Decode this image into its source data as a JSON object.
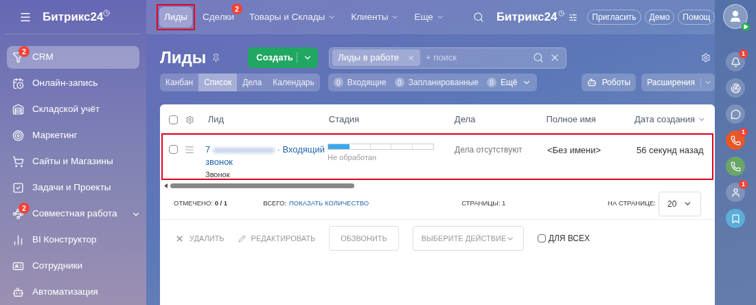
{
  "sidebar": {
    "logo": "Битрикс24",
    "items": [
      {
        "label": "CRM",
        "badge": "2",
        "selected": true
      },
      {
        "label": "Онлайн-запись",
        "selected": false
      },
      {
        "label": "Складской учёт",
        "selected": false
      },
      {
        "label": "Маркетинг",
        "selected": false
      },
      {
        "label": "Сайты и Магазины",
        "selected": false
      },
      {
        "label": "Задачи и Проекты",
        "selected": false
      },
      {
        "label": "Совместная работа",
        "badge": "2",
        "expandable": true,
        "selected": false
      },
      {
        "label": "BI Конструктор",
        "selected": false
      },
      {
        "label": "Сотрудники",
        "selected": false
      },
      {
        "label": "Автоматизация",
        "selected": false
      }
    ]
  },
  "topnav": {
    "tabs": [
      {
        "label": "Лиды",
        "selected": true,
        "highlighted": true
      },
      {
        "label": "Сделки",
        "badge": "2",
        "selected": false
      },
      {
        "label": "Товары и Склады",
        "dropdown": true,
        "selected": false
      },
      {
        "label": "Клиенты",
        "dropdown": true,
        "selected": false
      },
      {
        "label": "Еще",
        "dropdown": true,
        "selected": false
      }
    ],
    "logo": "Битрикс24",
    "buttons": [
      "Пригласить",
      "Демо",
      "Помощ"
    ]
  },
  "header": {
    "title": "Лиды",
    "create": "Создать",
    "filter_chip": "Лиды в работе",
    "search_placeholder": "+ поиск"
  },
  "views": [
    {
      "label": "Канбан",
      "selected": false
    },
    {
      "label": "Список",
      "selected": true
    },
    {
      "label": "Дела",
      "selected": false
    },
    {
      "label": "Календарь",
      "selected": false
    }
  ],
  "counters": [
    {
      "count": "0",
      "label": "Входящие"
    },
    {
      "count": "0",
      "label": "Запланированные"
    },
    {
      "count": "0",
      "label": "Ещё",
      "dropdown": true
    }
  ],
  "toolbar": {
    "robots": "Роботы",
    "extensions": "Расширения"
  },
  "table": {
    "all_checked": false,
    "columns": [
      "Лид",
      "Стадия",
      "Дела",
      "Полное имя",
      "Дата создания"
    ],
    "rows": [
      {
        "highlighted": true,
        "checked": false,
        "lead_prefix": "7",
        "lead_suffix": "· Входящий звонок",
        "source": "Звонок",
        "stage": {
          "label": "Не обработан",
          "level": 0.2
        },
        "activities": "Дела отсутствуют",
        "name": "<Без имени>",
        "created": "56 секунд назад"
      }
    ]
  },
  "footer": {
    "checked_label": "ОТМЕЧЕНО:",
    "checked_value": "0 / 1",
    "total_label": "ВСЕГО:",
    "total_link": "ПОКАЗАТЬ КОЛИЧЕСТВО",
    "pages_label": "СТРАНИЦЫ:",
    "pages_value": "1",
    "per_page_label": "НА СТРАНИЦЕ:",
    "per_page": "20"
  },
  "actions": {
    "delete": "УДАЛИТЬ",
    "edit": "РЕДАКТИРОВАТЬ",
    "call": "ОБЗВОНИТЬ",
    "select_action": "ВЫБЕРИТЕ ДЕЙСТВИЕ",
    "for_all": "ДЛЯ ВСЕХ",
    "for_all_checked": false
  },
  "rail": [
    {
      "kind": "bell",
      "badge": "1"
    },
    {
      "kind": "radar"
    },
    {
      "kind": "chat"
    },
    {
      "kind": "phone",
      "color": "#e8572a",
      "badge": "1"
    },
    {
      "kind": "phone",
      "color": "#6aa56a"
    },
    {
      "kind": "avatar",
      "badge": "1"
    },
    {
      "kind": "bookmark",
      "color": "#5aaed8"
    }
  ]
}
